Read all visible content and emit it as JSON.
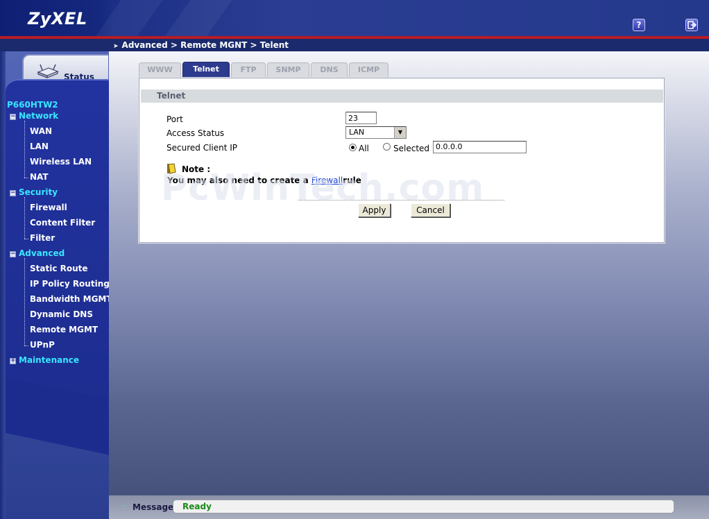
{
  "brand": {
    "logo_text": "ZyXEL"
  },
  "header": {
    "help_icon": "help-icon",
    "logout_icon": "logout-icon",
    "help_glyph": "?"
  },
  "breadcrumb": "Advanced > Remote MGNT > Telent",
  "sidebar": {
    "status_label": "Status",
    "device_name": "P660HTW2",
    "groups": [
      {
        "label": "Network",
        "expanded": true,
        "items": [
          "WAN",
          "LAN",
          "Wireless LAN",
          "NAT"
        ]
      },
      {
        "label": "Security",
        "expanded": true,
        "items": [
          "Firewall",
          "Content Filter",
          "Filter"
        ]
      },
      {
        "label": "Advanced",
        "expanded": true,
        "items": [
          "Static Route",
          "IP Policy Routing",
          "Bandwidth MGMT",
          "Dynamic DNS",
          "Remote MGMT",
          "UPnP"
        ]
      },
      {
        "label": "Maintenance",
        "expanded": false,
        "items": []
      }
    ]
  },
  "tabs": [
    {
      "label": "WWW",
      "active": false
    },
    {
      "label": "Telnet",
      "active": true
    },
    {
      "label": "FTP",
      "active": false
    },
    {
      "label": "SNMP",
      "active": false
    },
    {
      "label": "DNS",
      "active": false
    },
    {
      "label": "ICMP",
      "active": false
    }
  ],
  "section_title": "Telnet",
  "form": {
    "port_label": "Port",
    "port_value": "23",
    "access_status_label": "Access Status",
    "access_status_value": "LAN",
    "secured_ip_label": "Secured Client IP",
    "radio_all_label": "All",
    "radio_selected_label": "Selected",
    "selected_option": "All",
    "ip_value": "0.0.0.0"
  },
  "note": {
    "title": "Note :",
    "text_before": "You may also need to create a ",
    "link_text": "Firewall",
    "text_after": "rule"
  },
  "buttons": {
    "apply": "Apply",
    "cancel": "Cancel"
  },
  "watermark": "PcWinTech.com",
  "statusbar": {
    "label": "Message",
    "value": "Ready"
  },
  "colors": {
    "accent_cyan": "#39e6ff",
    "header_red": "#b81c26",
    "active_tab": "#2c3b8e",
    "ready_green": "#1a8a1a"
  }
}
